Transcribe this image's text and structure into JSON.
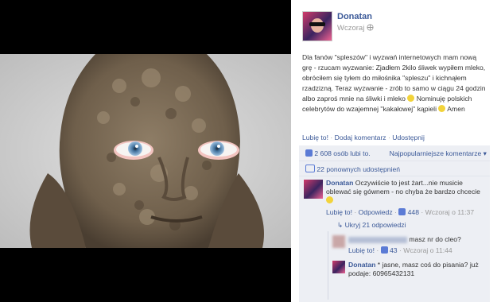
{
  "post": {
    "author": "Donatan",
    "time": "Wczoraj",
    "text": "Dla fanów \"spleszów\" i wyzwań internetowych mam nową grę - rzucam wyzwanie: Zjadłem 2kilo śliwek wypiłem mleko, obróciłem się tyłem do miłośnika \"spleszu\" i kichnąłem rzadzizną. Teraz wyzwanie - zrób to samo w ciągu 24 godzin albo zaproś mnie na śliwki i mleko",
    "text_after": "Nominuję polskich celebrytów do wzajemnej \"kakałowej\" kąpieli",
    "text_end": "Amen",
    "actions": {
      "like": "Lubię to!",
      "comment": "Dodaj komentarz",
      "share": "Udostępnij",
      "sep": "·"
    }
  },
  "stats": {
    "likes": "2 608 osób lubi to.",
    "sort": "Najpopularniejsze komentarze",
    "shares": "22 ponownych udostępnień"
  },
  "comment1": {
    "author": "Donatan",
    "text": "Oczywiście to jest żart...nie musicie oblewać się gównem - no chyba że bardzo chcecie",
    "like": "Lubię to!",
    "reply": "Odpowiedz",
    "likes": "448",
    "time": "Wczoraj o 11:37",
    "replies_link": "Ukryj 21 odpowiedzi"
  },
  "reply1": {
    "text": "masz nr do cleo?",
    "like": "Lubię to!",
    "likes": "43",
    "time": "Wczoraj o 11:44"
  },
  "reply2": {
    "author": "Donatan",
    "text": "* jasne, masz coś do pisania? już podaje: 60965432131"
  }
}
